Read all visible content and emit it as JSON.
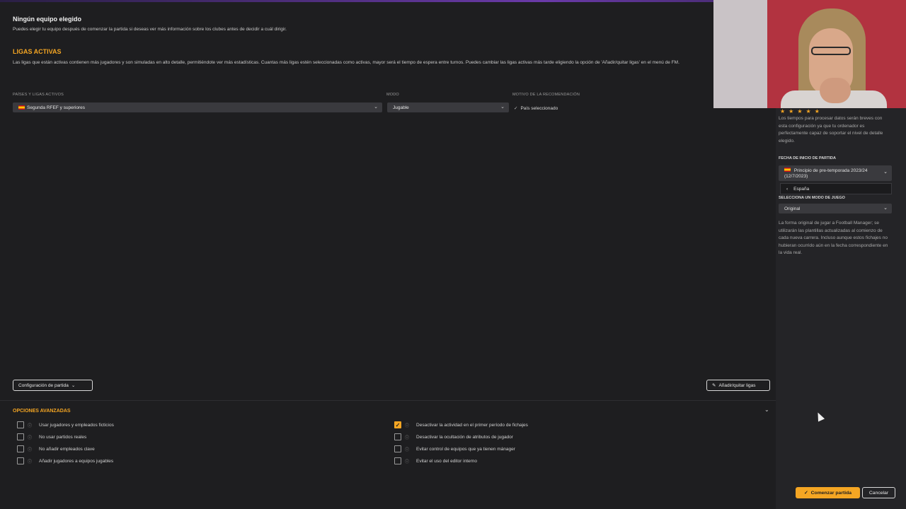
{
  "header": {
    "title": "Ningún equipo elegido",
    "description": "Puedes elegir tu equipo después de comenzar la partida si deseas ver más información sobre los clubes antes de decidir a cuál dirigir."
  },
  "ligas": {
    "title": "LIGAS ACTIVAS",
    "description": "Las ligas que están activas contienen más jugadores y son simuladas en alto detalle, permitiéndote ver más estadísticas. Cuantas más ligas estén seleccionadas como activas, mayor será el tiempo de espera entre turnos. Puedes cambiar las ligas activas más tarde eligiendo la opción de 'Añadir/quitar ligas' en el menú de FM.",
    "columns": {
      "paises": "PAÍSES Y LIGAS ACTIVOS",
      "modo": "MODO",
      "motivo": "MOTIVO DE LA RECOMENDACIÓN"
    },
    "row": {
      "liga": "Segunda RFEF y superiores",
      "modo": "Jugable",
      "motivo": "País seleccionado"
    }
  },
  "buttons": {
    "config": "Configuración de partida",
    "add_remove": "Añadir/quitar ligas",
    "start": "Comenzar partida",
    "cancel": "Cancelar"
  },
  "advanced": {
    "title": "OPCIONES AVANZADAS",
    "left": [
      {
        "label": "Usar jugadores y empleados ficticios",
        "checked": false
      },
      {
        "label": "No usar partidos reales",
        "checked": false
      },
      {
        "label": "No añadir empleados clave",
        "checked": false
      },
      {
        "label": "Añadir jugadores a equipos jugables",
        "checked": false
      }
    ],
    "right": [
      {
        "label": "Desactivar la actividad en el primer período de fichajes",
        "checked": true
      },
      {
        "label": "Desactivar la ocultación de atributos de jugador",
        "checked": false
      },
      {
        "label": "Evitar control de equipos que ya tienen mánager",
        "checked": false
      },
      {
        "label": "Evitar el uso del editor interno",
        "checked": false
      }
    ]
  },
  "sidebar": {
    "stars": "★★★★★",
    "detail_text": "Los tiempos para procesar datos serán breves con esta configuración ya que tu ordenador es perfectamente capaz de soportar el nivel de detalle elegido.",
    "fecha_label": "FECHA DE INICIO DE PARTIDA",
    "fecha_value": "Principio de pre-temporada 2023/24 (12/7/2023)",
    "popup_item": "España",
    "modo_label": "SELECCIONA UN MODO DE JUEGO",
    "modo_value": "Original",
    "modo_text": "La forma original de jugar a Football Manager; se utilizarán las plantillas actualizadas al comienzo de cada nueva carrera. Incluso aunque estos fichajes no hubieran ocurrido aún en la fecha correspondiente en la vida real."
  },
  "colors": {
    "accent": "#f5a623",
    "background": "#1e1e20",
    "sidebar": "#242427"
  }
}
